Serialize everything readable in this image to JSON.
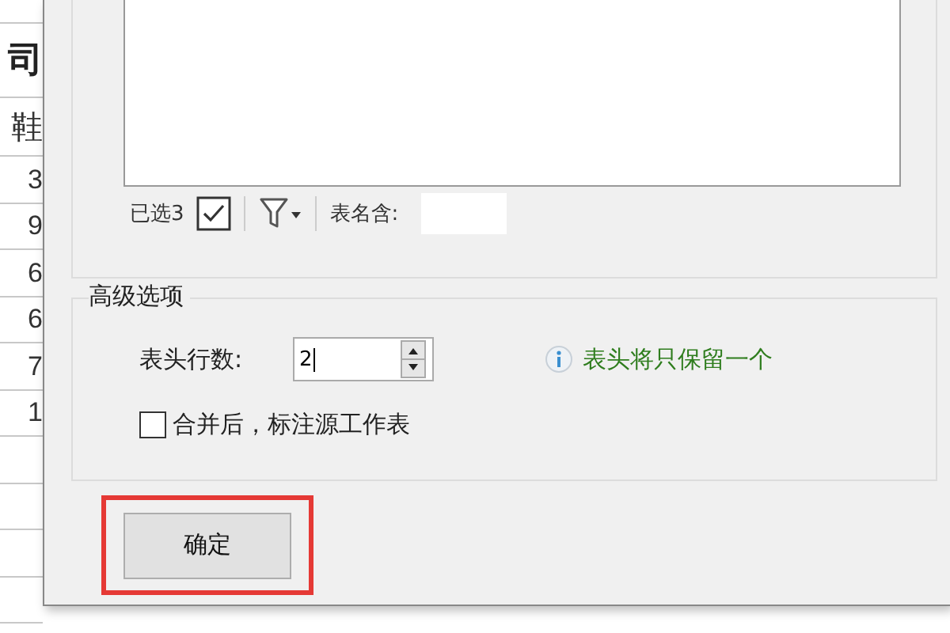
{
  "spreadsheet": {
    "cells": [
      "司",
      "鞋",
      "3",
      "9",
      "6",
      "6",
      "7",
      "1"
    ]
  },
  "sheet_list": {
    "selected_count": "已选3",
    "name_filter_label": "表名含:"
  },
  "advanced": {
    "title": "高级选项",
    "header_rows_label": "表头行数:",
    "header_rows_value": "2",
    "hint": "表头将只保留一个",
    "mark_source": {
      "label": "合并后，标注源工作表",
      "checked": false
    }
  },
  "ok_button": {
    "label": "确定",
    "highlighted": true
  }
}
